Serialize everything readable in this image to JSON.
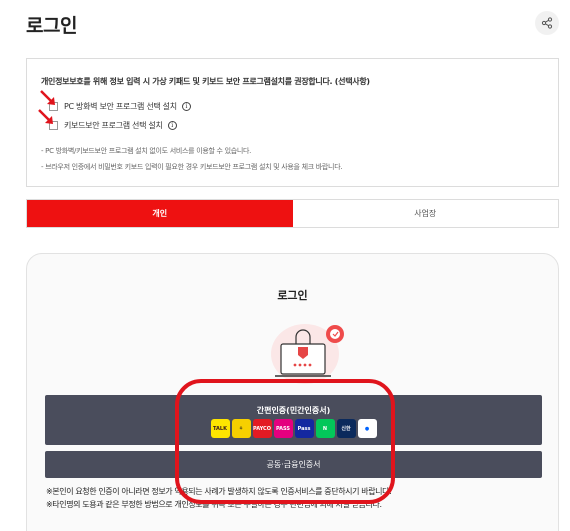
{
  "page": {
    "title": "로그인"
  },
  "header": {
    "share_icon": "share-icon"
  },
  "notice": {
    "title": "개인정보보호를 위해 정보 입력 시 가상 키패드 및 키보드 보안 프로그램설치를 권장합니다. (선택사항)",
    "options": [
      {
        "label": "PC 방화벽 보안 프로그램 선택 설치",
        "checked": false
      },
      {
        "label": "키보드보안 프로그램 선택 설치",
        "checked": false
      }
    ],
    "notes": [
      "- PC 방화벽/키보드보안 프로그램 설치 없이도 서비스를 이용할 수 있습니다.",
      "- 브라우저 인증에서 비밀번호 키보드 입력이 필요한 경우 키보드보안 프로그램 설치 및 사용을 체크 바랍니다."
    ],
    "info_glyph": "i"
  },
  "tabs": [
    {
      "label": "개인",
      "active": true
    },
    {
      "label": "사업장",
      "active": false
    }
  ],
  "login": {
    "title": "로그인",
    "simple_auth_label": "간편인증(민간인증서)",
    "providers": [
      {
        "name": "kakao",
        "text": "TALK",
        "bg": "#fee500",
        "fg": "#3a1d1d"
      },
      {
        "name": "toss-like",
        "text": "⚘",
        "bg": "#f6d000",
        "fg": "#222222"
      },
      {
        "name": "payco",
        "text": "PAYCO",
        "bg": "#e31b23",
        "fg": "#ffffff"
      },
      {
        "name": "pass",
        "text": "PASS",
        "bg": "#e4007f",
        "fg": "#ffffff"
      },
      {
        "name": "samsung-pass",
        "text": "Pass",
        "bg": "#1428a0",
        "fg": "#ffffff"
      },
      {
        "name": "naver",
        "text": "N",
        "bg": "#03c75a",
        "fg": "#ffffff"
      },
      {
        "name": "shinhan",
        "text": "신한",
        "bg": "#0b2a5c",
        "fg": "#ffffff"
      },
      {
        "name": "toss",
        "text": "●",
        "bg": "#ffffff",
        "fg": "#0064ff"
      }
    ],
    "cert_label": "공동·금융인증서",
    "warnings": [
      "※본인이 요청한 인증이 아니라면 정보가 악용되는 사례가 발생하지 않도록 인증서비스를 중단하시기 바랍니다.",
      "※타인명의 도용과 같은 부정한 방법으로 개인정보를 취득 또는 누설하는 경우 관련법에 의해 처벌 받습니다."
    ]
  },
  "colors": {
    "accent": "#ee1111",
    "button_dark": "#4a4d5c",
    "annotation": "#e0141c"
  }
}
